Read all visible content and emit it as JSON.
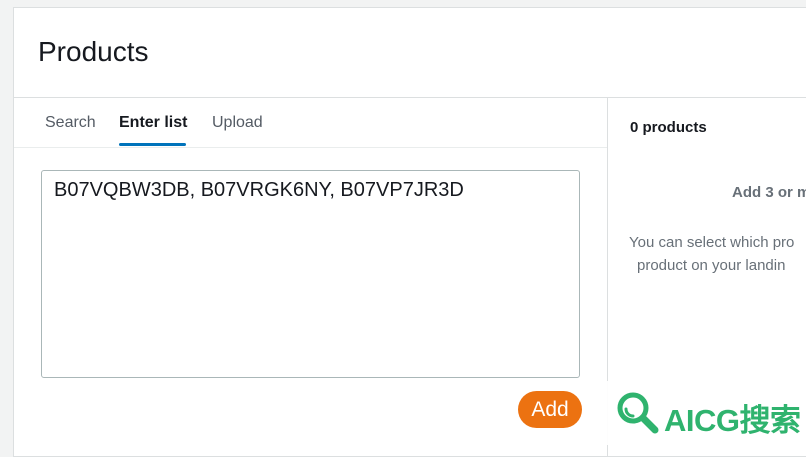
{
  "header": {
    "title": "Products"
  },
  "tabs": [
    {
      "label": "Search",
      "active": false
    },
    {
      "label": "Enter list",
      "active": true
    },
    {
      "label": "Upload",
      "active": false
    }
  ],
  "list_input": {
    "value": "B07VQBW3DB, B07VRGK6NY, B07VP7JR3D"
  },
  "add_button": {
    "label": "Add"
  },
  "right_panel": {
    "count_label": "0 products",
    "empty_title": "Add 3 or m",
    "empty_desc_line1": "You can select which pro",
    "empty_desc_line2": "product on your landin"
  },
  "watermark": {
    "text": "AICG搜索"
  },
  "colors": {
    "accent_tab": "#0073bb",
    "add_button": "#ec7211",
    "watermark": "#2fb36e"
  }
}
